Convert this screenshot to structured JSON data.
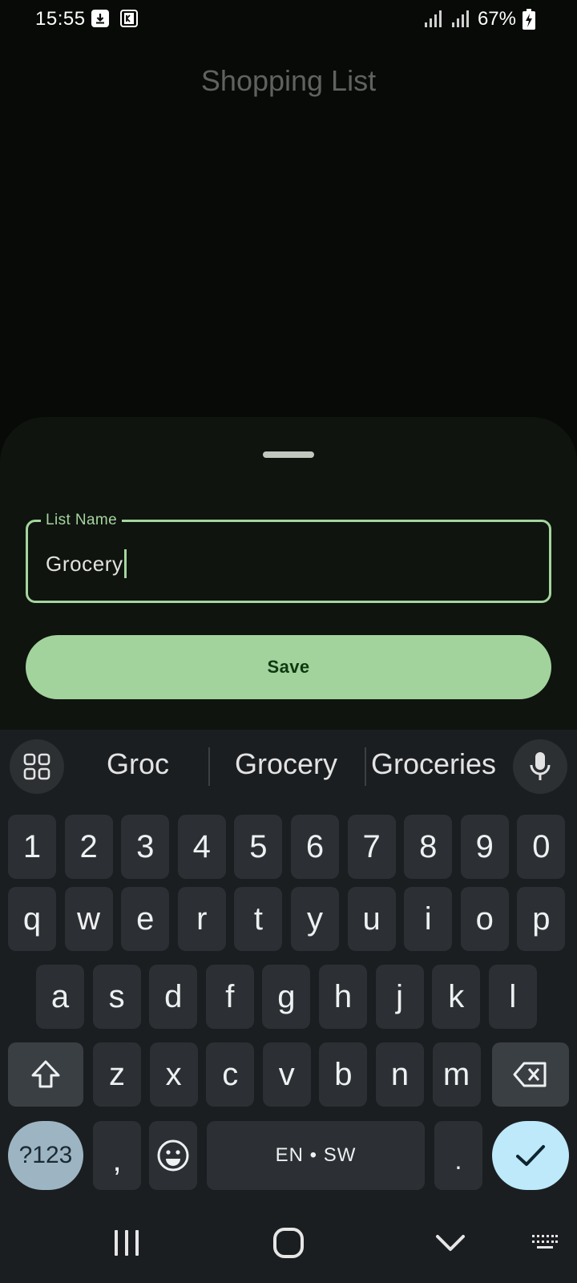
{
  "status_bar": {
    "time": "15:55",
    "battery": "67%",
    "notification_icons": [
      "download-icon",
      "k-app-icon"
    ]
  },
  "app": {
    "title": "Shopping List"
  },
  "sheet": {
    "field_label": "List Name",
    "field_value": "Grocery",
    "save_label": "Save"
  },
  "keyboard": {
    "suggestions": [
      "Groc",
      "Grocery",
      "Groceries"
    ],
    "number_row": [
      "1",
      "2",
      "3",
      "4",
      "5",
      "6",
      "7",
      "8",
      "9",
      "0"
    ],
    "row1": [
      "q",
      "w",
      "e",
      "r",
      "t",
      "y",
      "u",
      "i",
      "o",
      "p"
    ],
    "row2": [
      "a",
      "s",
      "d",
      "f",
      "g",
      "h",
      "j",
      "k",
      "l"
    ],
    "row3": [
      "z",
      "x",
      "c",
      "v",
      "b",
      "n",
      "m"
    ],
    "symbols_label": "?123",
    "comma": ",",
    "space_label": "EN • SW",
    "period": "."
  },
  "colors": {
    "accent": "#a5d59e",
    "save_button": "#a3d39c",
    "enter_key": "#bde9fb",
    "symbols_key": "#9db5c2"
  }
}
